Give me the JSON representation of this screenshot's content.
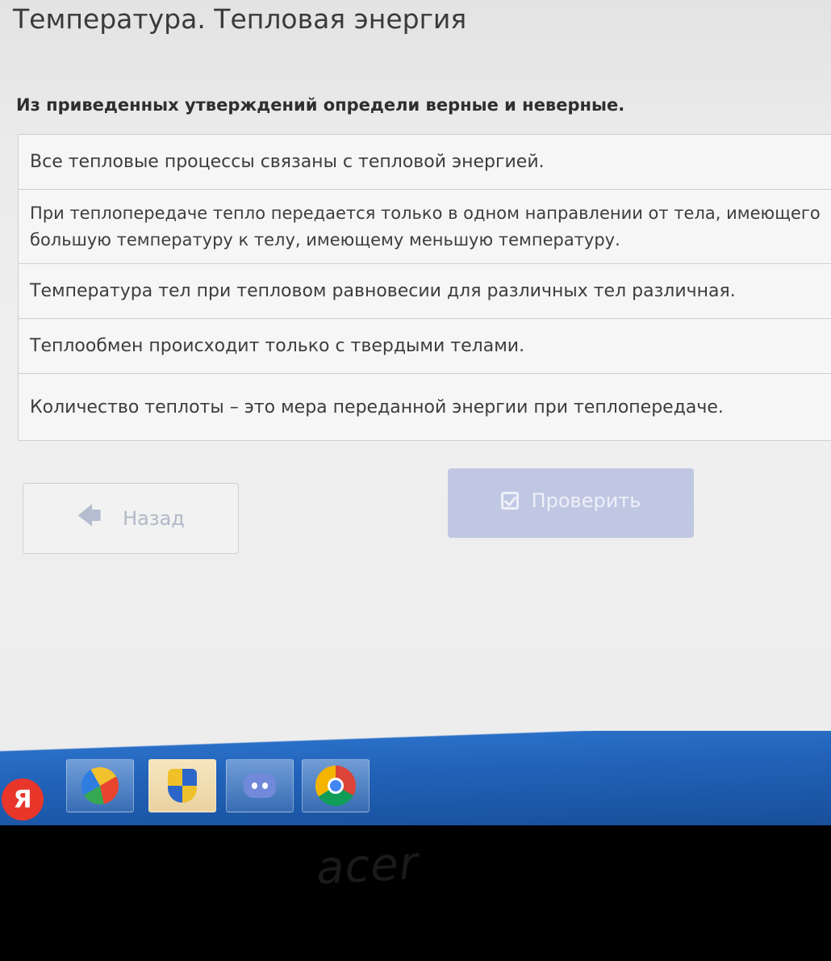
{
  "lesson": {
    "title": "Температура. Тепловая энергия"
  },
  "task": {
    "question": "Из приведенных утверждений определи верные и неверные.",
    "statements": [
      {
        "text": "Все тепловые процессы связаны с тепловой энергией."
      },
      {
        "text": "При теплопередаче тепло передается только в одном направлении от тела, имеющего большую температуру к телу, имеющему меньшую температуру."
      },
      {
        "text": "Температура тел при тепловом равновесии для различных тел различная."
      },
      {
        "text": "Теплообмен происходит только с твердыми телами."
      },
      {
        "text": "Количество теплоты – это мера переданной энергии при теплопередаче."
      }
    ]
  },
  "buttons": {
    "back_label": "Назад",
    "back_icon": "arrow-left-icon",
    "check_label": "Проверить",
    "check_icon": "checkbox-icon",
    "check_color": "#c0c7e3"
  },
  "taskbar": {
    "yandex_label": "Я",
    "apps": [
      "yandex-browser-icon",
      "windows-shield-icon",
      "discord-icon",
      "chrome-icon"
    ],
    "color": "#2162b8"
  },
  "bezel": {
    "brand": "acer"
  }
}
